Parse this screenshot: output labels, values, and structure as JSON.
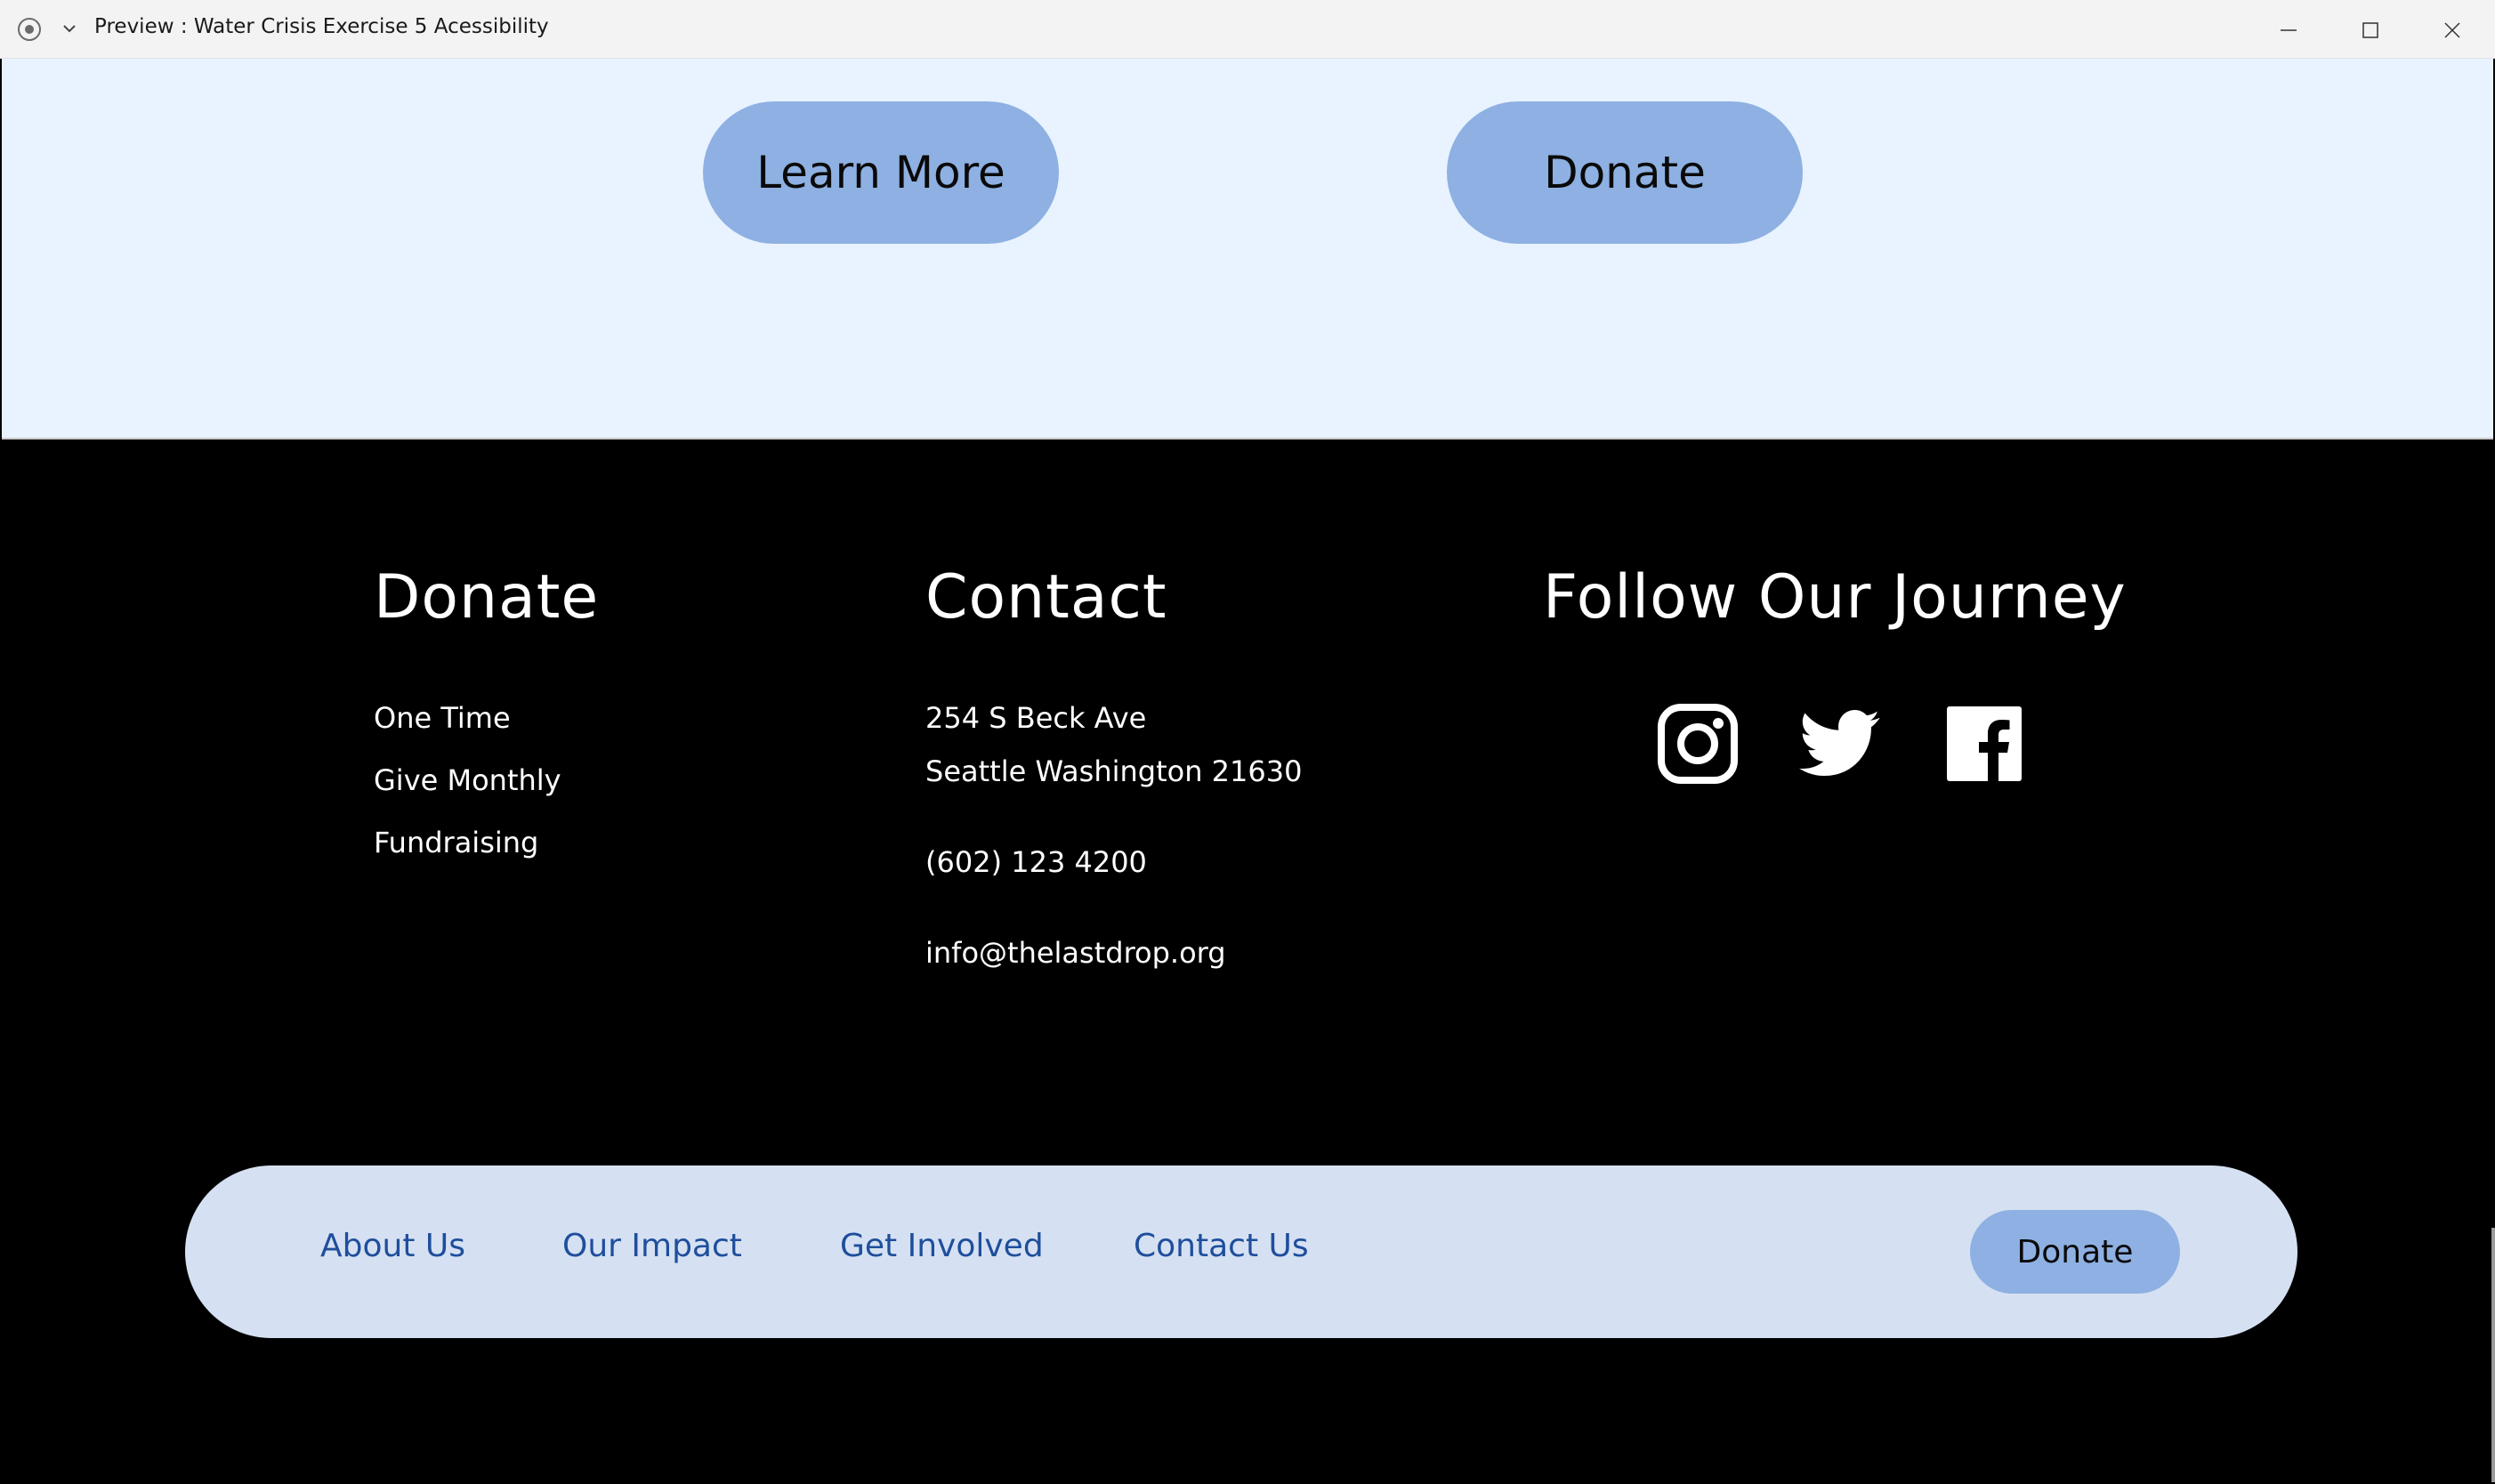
{
  "window": {
    "title": "Preview : Water Crisis Exercise 5 Acessibility"
  },
  "hero": {
    "learn_more_label": "Learn More",
    "donate_label": "Donate"
  },
  "footer": {
    "donate_column": {
      "heading": "Donate",
      "links": [
        "One Time",
        "Give Monthly",
        "Fundraising"
      ]
    },
    "contact_column": {
      "heading": "Contact",
      "address_line1": "254 S Beck Ave",
      "address_line2": "Seattle Washington 21630",
      "phone": "(602) 123 4200",
      "email": "info@thelastdrop.org"
    },
    "follow_column": {
      "heading": "Follow Our Journey",
      "icons": [
        "instagram-icon",
        "twitter-icon",
        "facebook-icon"
      ]
    }
  },
  "navbar": {
    "links": [
      "About Us",
      "Our Impact",
      "Get Involved",
      "Contact Us"
    ],
    "donate_label": "Donate"
  },
  "colors": {
    "hero_bg": "#e8f3ff",
    "button_bg": "#8eb0e2",
    "footer_bg": "#000000",
    "nav_bg": "#d5e1f2",
    "nav_link": "#1f4e9c"
  }
}
